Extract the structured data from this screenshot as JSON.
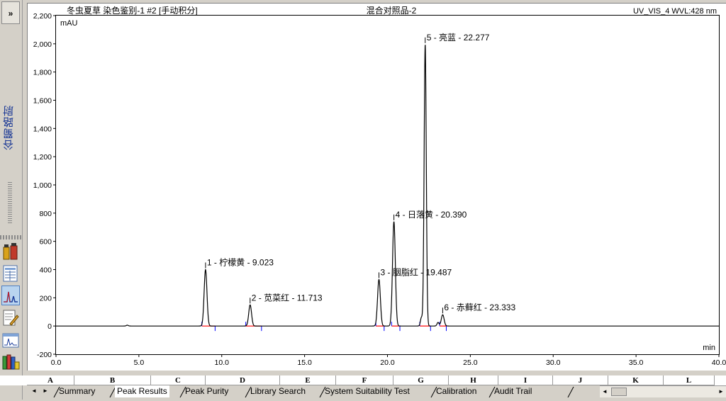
{
  "sidebar": {
    "toggle_label": "»",
    "label": "谷蜀路尉"
  },
  "tools": [
    {
      "icon": "bottles-icon"
    },
    {
      "icon": "report-grid-icon"
    },
    {
      "icon": "chromatogram-icon"
    },
    {
      "icon": "edit-document-icon"
    },
    {
      "icon": "spectrum-window-icon"
    },
    {
      "icon": "sample-vials-icon"
    }
  ],
  "chart_header": {
    "left": "冬虫夏草 染色鉴别-1 #2 [手动积分]",
    "center": "混合对照品-2",
    "right": "UV_VIS_4 WVL:428 nm"
  },
  "chart_data": {
    "type": "line",
    "ylabel": "mAU",
    "xlabel": "min",
    "xlim": [
      0.0,
      40.0
    ],
    "ylim": [
      -200,
      2200
    ],
    "x_ticks": [
      0.0,
      5.0,
      10.0,
      15.0,
      20.0,
      25.0,
      30.0,
      35.0,
      40.0
    ],
    "x_tick_labels": [
      "0.0",
      "5.0",
      "10.0",
      "15.0",
      "20.0",
      "25.0",
      "30.0",
      "35.0",
      "40.0"
    ],
    "y_ticks": [
      -200,
      0,
      200,
      400,
      600,
      800,
      1000,
      1200,
      1400,
      1600,
      1800,
      2000,
      2200
    ],
    "y_tick_labels": [
      "-200",
      "0",
      "200",
      "400",
      "600",
      "800",
      "1,000",
      "1,200",
      "1,400",
      "1,600",
      "1,800",
      "2,000",
      "2,200"
    ],
    "peaks": [
      {
        "label": "1 - 柠檬黄 - 9.023",
        "rt": 9.023,
        "height": 400
      },
      {
        "label": "2 - 苋菜红 - 11.713",
        "rt": 11.713,
        "height": 150
      },
      {
        "label": "3 - 胭脂红 - 19.487",
        "rt": 19.487,
        "height": 330
      },
      {
        "label": "4 - 日落黄 - 20.390",
        "rt": 20.39,
        "height": 740
      },
      {
        "label": "5 - 亮蓝 - 22.277",
        "rt": 22.277,
        "height": 1995
      },
      {
        "label": "6 - 赤藓红 - 23.333",
        "rt": 23.333,
        "height": 80
      }
    ],
    "minor_peaks": [
      {
        "rt": 4.3,
        "height": 6
      },
      {
        "rt": 22.05,
        "height": 60
      },
      {
        "rt": 23.05,
        "height": 25
      }
    ],
    "integration_marks": [
      {
        "start": 8.8,
        "end": 9.6
      },
      {
        "start": 11.45,
        "end": 12.4
      },
      {
        "start": 19.3,
        "end": 19.8
      },
      {
        "start": 20.25,
        "end": 20.75
      },
      {
        "start": 21.95,
        "end": 22.6
      },
      {
        "start": 23.15,
        "end": 23.55
      }
    ],
    "colors": {
      "trace": "#000000",
      "baseline": "#ff0000",
      "marker": "#0000ff"
    }
  },
  "sheet": {
    "columns": [
      "A",
      "B",
      "C",
      "D",
      "E",
      "F",
      "G",
      "H",
      "I",
      "J",
      "K",
      "L"
    ],
    "tabs": [
      "Summary",
      "Peak Results",
      "Peak Purity",
      "Library Search",
      "System Suitability Test",
      "Calibration",
      "Audit Trail"
    ],
    "active_tab": "Peak Results",
    "nav_left": "◄",
    "nav_right": "►"
  }
}
